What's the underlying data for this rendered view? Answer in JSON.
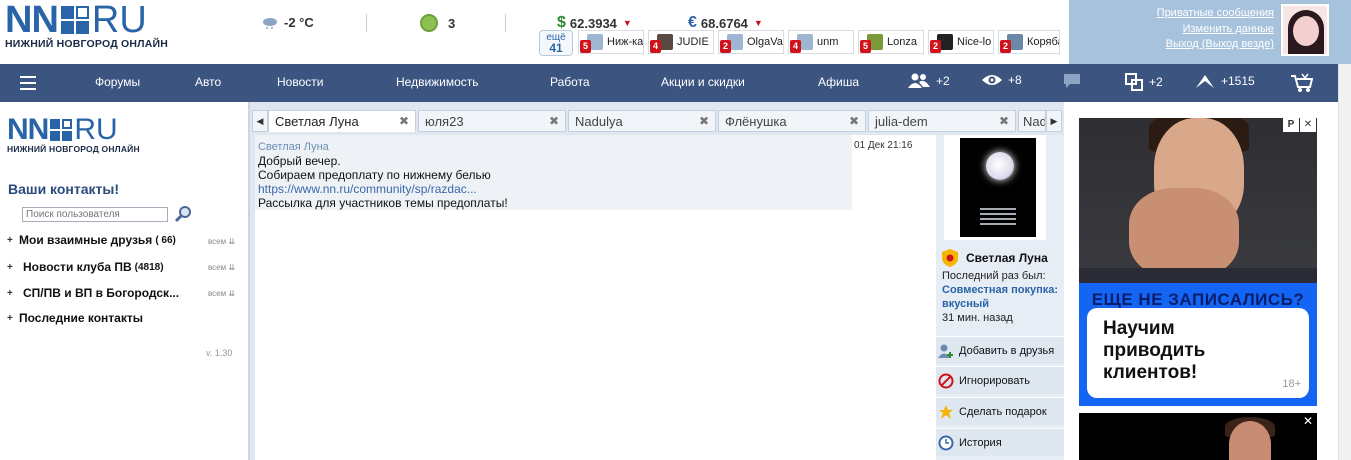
{
  "header": {
    "logo": {
      "nn": "NN",
      "ru": "RU",
      "tagline": "НИЖНИЙ НОВГОРОД ОНЛАЙН"
    },
    "weather": {
      "icon": "cloud-snow-icon",
      "temp": "-2 °C"
    },
    "traffic": {
      "icon": "traffic-icon",
      "level": "3"
    },
    "currency": {
      "usd": {
        "symbol": "$",
        "value": "62.3934",
        "trend": "▼"
      },
      "eur": {
        "symbol": "€",
        "value": "68.6764",
        "trend": "▼"
      }
    },
    "online": {
      "more_label": "ещё",
      "more_count": "41",
      "users": [
        {
          "count": "5",
          "name": "Ниж-ка"
        },
        {
          "count": "4",
          "name": "JUDIE"
        },
        {
          "count": "2",
          "name": "OlgaVa"
        },
        {
          "count": "4",
          "name": "unm"
        },
        {
          "count": "5",
          "name": "Lonza"
        },
        {
          "count": "2",
          "name": "Nice-lo"
        },
        {
          "count": "2",
          "name": "Коряба"
        }
      ]
    },
    "user_menu": {
      "private_messages": "Приватные сообщения",
      "edit_profile": "Изменить данные",
      "logout": "Выход (Выход везде)"
    }
  },
  "nav": {
    "items": [
      "Форумы",
      "Авто",
      "Новости",
      "Недвижимость",
      "Работа",
      "Акции и скидки",
      "Афиша"
    ],
    "counters": {
      "friends": "+2",
      "views": "+8",
      "shares": "+2",
      "rating": "+1515"
    }
  },
  "sidebar": {
    "logo": {
      "nn": "NN",
      "ru": "RU",
      "tagline": "НИЖНИЙ НОВГОРОД ОНЛАЙН"
    },
    "title": "Ваши контакты!",
    "search_placeholder": "Поиск пользователя",
    "groups": [
      {
        "label": "Мои взаимные друзья",
        "count": "( 66)",
        "all": "всем"
      },
      {
        "label": "Новости клуба ПВ",
        "count": "(4818)",
        "all": "всем"
      },
      {
        "label": "СП/ПВ и ВП в Богородск...",
        "count": "",
        "all": "всем"
      },
      {
        "label": "Последние контакты",
        "count": "",
        "all": ""
      }
    ],
    "version": "v. 1.30"
  },
  "chat": {
    "tabs": [
      "Светлая Луна",
      "юля23",
      "Nadulya",
      "Флёнушка",
      "julia-dem",
      "Nad"
    ],
    "message": {
      "author": "Светлая Луна",
      "time": "01 Дек 21:16",
      "lines": [
        "Добрый вечер.",
        "Собираем предоплату по нижнему белью"
      ],
      "link": "https://www.nn.ru/community/sp/razdac...",
      "footer": "Рассылка для участников темы предоплаты!"
    },
    "profile": {
      "name": "Светлая Луна",
      "last_seen_label": "Последний раз был:",
      "last_seen_place": "Совместная покупка: вкусный",
      "last_seen_ago": "31 мин. назад",
      "actions": [
        "Добавить в друзья",
        "Игнорировать",
        "Сделать подарок",
        "История"
      ]
    }
  },
  "ads": {
    "ad1": {
      "marker": "Р",
      "close": "✕",
      "headline": "ЕЩЕ НЕ ЗАПИСАЛИСЬ?",
      "text_lines": [
        "Научим",
        "приводить",
        "клиентов!"
      ],
      "age": "18+"
    },
    "ad2": {
      "close": "✕"
    }
  },
  "colors": {
    "nav_bg": "#3b5480",
    "brand_blue": "#2a64a8",
    "user_panel": "#a7c2dd",
    "ad_blue": "#1565f5",
    "badge_red": "#d0121a"
  }
}
